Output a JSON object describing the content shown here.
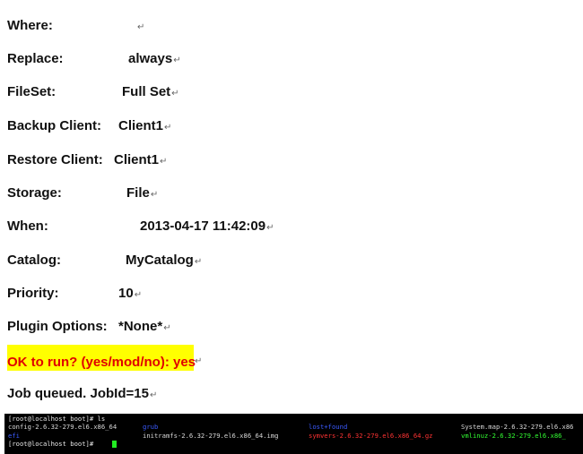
{
  "document": {
    "top_clip": "[partially visible line cut off above]",
    "rows": [
      {
        "label": "Where:",
        "value": ""
      },
      {
        "label": "Replace:",
        "value": "always"
      },
      {
        "label": "FileSet:",
        "value": "Full Set"
      },
      {
        "label": "Backup Client:",
        "value": "Client1"
      },
      {
        "label": "Restore Client:",
        "value": "Client1"
      },
      {
        "label": "Storage:",
        "value": "File"
      },
      {
        "label": "When:",
        "value": "2013-04-17 11:42:09"
      },
      {
        "label": "Catalog:",
        "value": "MyCatalog"
      },
      {
        "label": "Priority:",
        "value": "10"
      },
      {
        "label": "Plugin Options:",
        "value": "*None*"
      }
    ],
    "prompt": "OK to run? (yes/mod/no): yes",
    "queued": "Job queued. JobId=15",
    "para_mark": "↵"
  },
  "terminal": {
    "line1": "[root@localhost boot]# ls",
    "files": {
      "config": "config-2.6.32-279.el6.x86_64",
      "grub": "grub",
      "initramfs": "initramfs-2.6.32-279.el6.x86_64.img",
      "lost_found": "lost+found",
      "symvers": "symvers-2.6.32-279.el6.x86_64.gz",
      "system_map": "System.map-2.6.32-279.el6.x86",
      "efi": "efi",
      "vmlinuz": "vmlinuz-2.6.32-279.el6.x86_"
    },
    "line3": "[root@localhost boot]#"
  },
  "colors": {
    "highlight": "#ffff00",
    "prompt_text": "#e00000",
    "terminal_bg": "#000000",
    "dir_blue": "#3b5bff",
    "archive_red": "#ff3333",
    "exec_green": "#33ff33"
  }
}
